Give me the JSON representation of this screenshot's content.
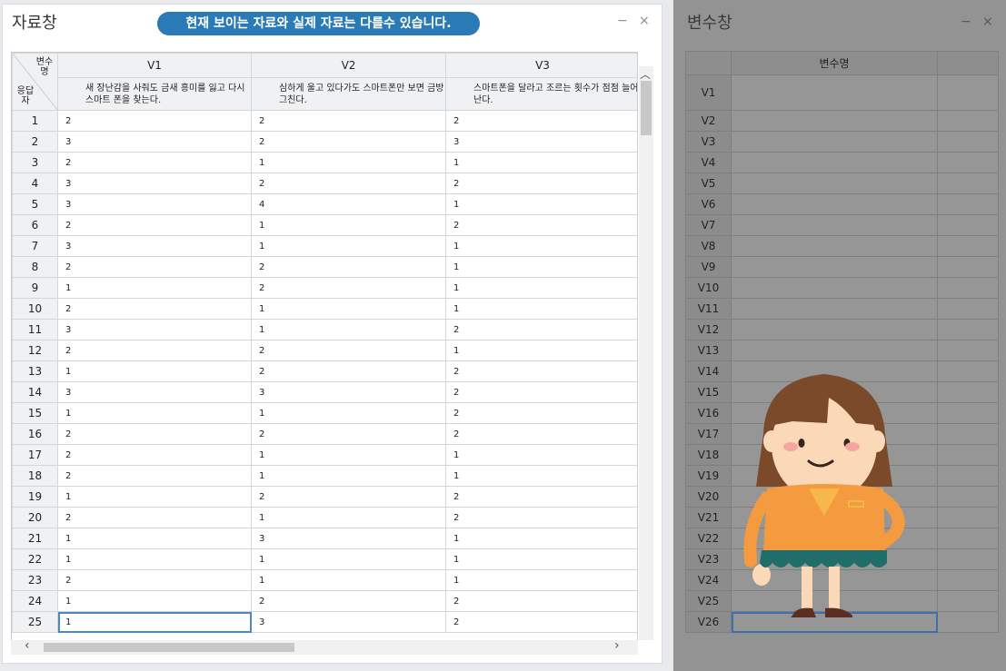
{
  "data_window": {
    "title": "자료창",
    "notice": "현재 보이는 자료와 실제 자료는 다를수 있습니다.",
    "corner_top": "변수명",
    "corner_bottom": "응답자",
    "columns": [
      {
        "name": "V1",
        "label": "새 장난감을 사줘도 금새 흥미를 잃고 다시 스마트 폰을 찾는다."
      },
      {
        "name": "V2",
        "label": "심하게 울고 있다가도 스마트폰만 보면 금방 그친다."
      },
      {
        "name": "V3",
        "label": "스마트폰을 달라고 조르는 횟수가 점점 늘어난다."
      }
    ],
    "rows": [
      {
        "id": "1",
        "values": [
          "2",
          "2",
          "2"
        ]
      },
      {
        "id": "2",
        "values": [
          "3",
          "2",
          "3"
        ]
      },
      {
        "id": "3",
        "values": [
          "2",
          "1",
          "1"
        ]
      },
      {
        "id": "4",
        "values": [
          "3",
          "2",
          "2"
        ]
      },
      {
        "id": "5",
        "values": [
          "3",
          "4",
          "1"
        ]
      },
      {
        "id": "6",
        "values": [
          "2",
          "1",
          "2"
        ]
      },
      {
        "id": "7",
        "values": [
          "3",
          "1",
          "1"
        ]
      },
      {
        "id": "8",
        "values": [
          "2",
          "2",
          "1"
        ]
      },
      {
        "id": "9",
        "values": [
          "1",
          "2",
          "1"
        ]
      },
      {
        "id": "10",
        "values": [
          "2",
          "1",
          "1"
        ]
      },
      {
        "id": "11",
        "values": [
          "3",
          "1",
          "2"
        ]
      },
      {
        "id": "12",
        "values": [
          "2",
          "2",
          "1"
        ]
      },
      {
        "id": "13",
        "values": [
          "1",
          "2",
          "2"
        ]
      },
      {
        "id": "14",
        "values": [
          "3",
          "3",
          "2"
        ]
      },
      {
        "id": "15",
        "values": [
          "1",
          "1",
          "2"
        ]
      },
      {
        "id": "16",
        "values": [
          "2",
          "2",
          "2"
        ]
      },
      {
        "id": "17",
        "values": [
          "2",
          "1",
          "1"
        ]
      },
      {
        "id": "18",
        "values": [
          "2",
          "1",
          "1"
        ]
      },
      {
        "id": "19",
        "values": [
          "1",
          "2",
          "2"
        ]
      },
      {
        "id": "20",
        "values": [
          "2",
          "1",
          "2"
        ]
      },
      {
        "id": "21",
        "values": [
          "1",
          "3",
          "1"
        ]
      },
      {
        "id": "22",
        "values": [
          "1",
          "1",
          "1"
        ]
      },
      {
        "id": "23",
        "values": [
          "2",
          "1",
          "1"
        ]
      },
      {
        "id": "24",
        "values": [
          "1",
          "2",
          "2"
        ]
      },
      {
        "id": "25",
        "values": [
          "1",
          "3",
          "2"
        ]
      }
    ]
  },
  "variable_window": {
    "title": "변수창",
    "header": "변수명",
    "variables": [
      "V1",
      "V2",
      "V3",
      "V4",
      "V5",
      "V6",
      "V7",
      "V8",
      "V9",
      "V10",
      "V11",
      "V12",
      "V13",
      "V14",
      "V15",
      "V16",
      "V17",
      "V18",
      "V19",
      "V20",
      "V21",
      "V22",
      "V23",
      "V24",
      "V25",
      "V26"
    ]
  },
  "window_controls": {
    "minimize": "−",
    "close": "×"
  },
  "scroll_icons": {
    "up": "chevron-up-icon",
    "left": "chevron-left-icon",
    "right": "chevron-right-icon"
  },
  "colors": {
    "notice_bg": "#2a7ab6",
    "selection": "#4a87c9",
    "var_window_bg": "#939393"
  }
}
